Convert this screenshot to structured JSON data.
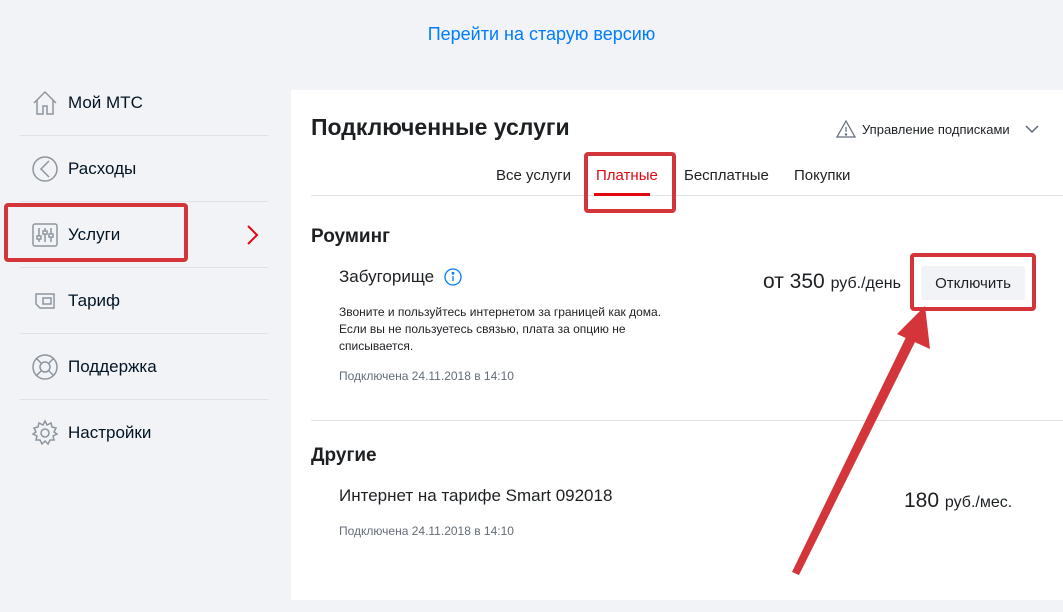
{
  "top_link": "Перейти на старую версию",
  "sidebar": {
    "items": [
      {
        "label": "Мой МТС",
        "icon": "home-icon"
      },
      {
        "label": "Расходы",
        "icon": "expenses-icon"
      },
      {
        "label": "Услуги",
        "icon": "sliders-icon",
        "active": true
      },
      {
        "label": "Тариф",
        "icon": "sim-card-icon"
      },
      {
        "label": "Поддержка",
        "icon": "lifebuoy-icon"
      },
      {
        "label": "Настройки",
        "icon": "gear-icon"
      }
    ]
  },
  "panel": {
    "title": "Подключенные услуги",
    "subscriptions_label": "Управление подписками",
    "tabs": [
      "Все услуги",
      "Платные",
      "Бесплатные",
      "Покупки"
    ],
    "active_tab": "Платные"
  },
  "sections": [
    {
      "title": "Роуминг",
      "service": {
        "name": "Забугорище",
        "description": "Звоните и пользуйтесь интернетом за границей как дома. Если вы не пользуетесь связью, плата за опцию не списывается.",
        "connected": "Подключена 24.11.2018 в 14:10",
        "price_prefix": "от 350",
        "price_unit": "руб./день",
        "action_label": "Отключить"
      }
    },
    {
      "title": "Другие",
      "service": {
        "name": "Интернет на тарифе Smart 092018",
        "connected": "Подключена 24.11.2018 в 14:10",
        "price_prefix": "180",
        "price_unit": "руб./мес."
      }
    }
  ],
  "colors": {
    "accent": "#e30611",
    "link": "#007cff",
    "annotation": "#d3353a",
    "background": "#f2f3f7"
  }
}
